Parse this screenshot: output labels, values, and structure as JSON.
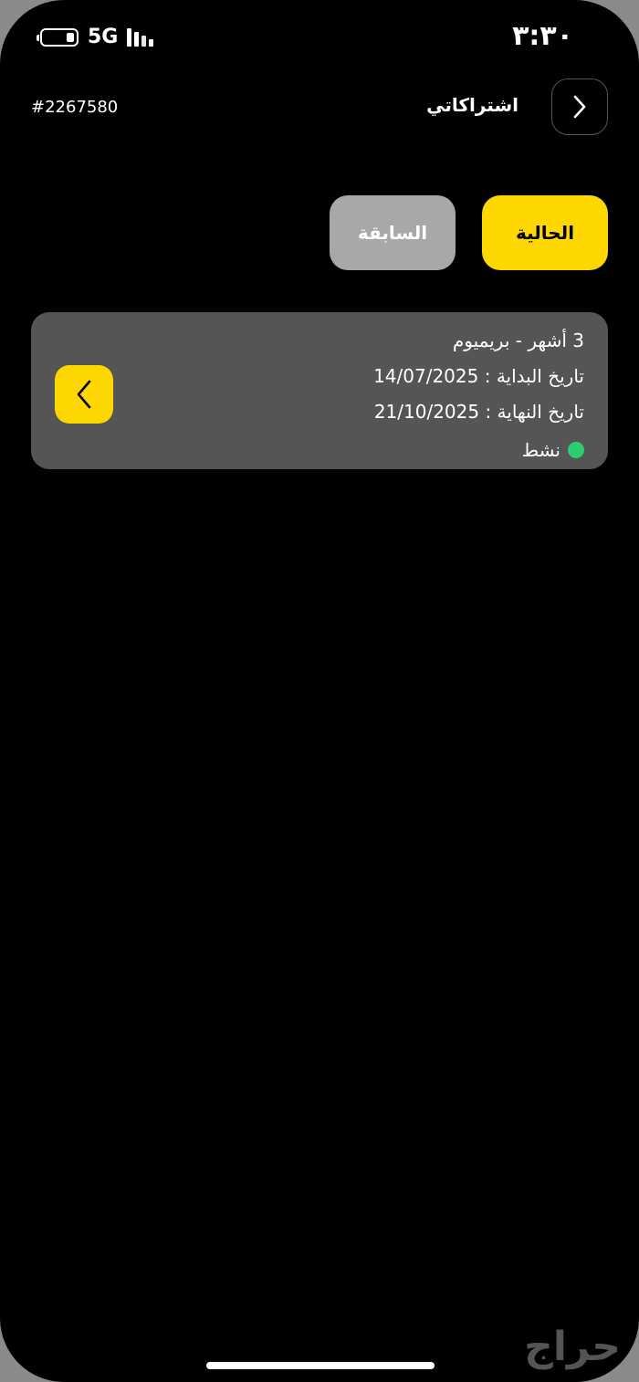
{
  "status_bar": {
    "network": "5G",
    "time": "٣:٣٠"
  },
  "header": {
    "title": "اشتراكاتي",
    "account_id": "#2267580",
    "back_icon": "chevron-right-icon"
  },
  "tabs": [
    {
      "label": "الحالية",
      "active": true
    },
    {
      "label": "السابقة",
      "active": false
    }
  ],
  "subscription": {
    "plan": "3 أشهر - بريميوم",
    "start_date": "تاريخ البداية : 14/07/2025",
    "end_date": "تاريخ النهاية : 21/10/2025",
    "status": "نشط",
    "status_color": "#2ecc71",
    "arrow_icon": "chevron-left-icon"
  },
  "watermark": "حراج",
  "colors": {
    "accent": "#ffd700",
    "background": "#000000",
    "card": "#555555"
  }
}
